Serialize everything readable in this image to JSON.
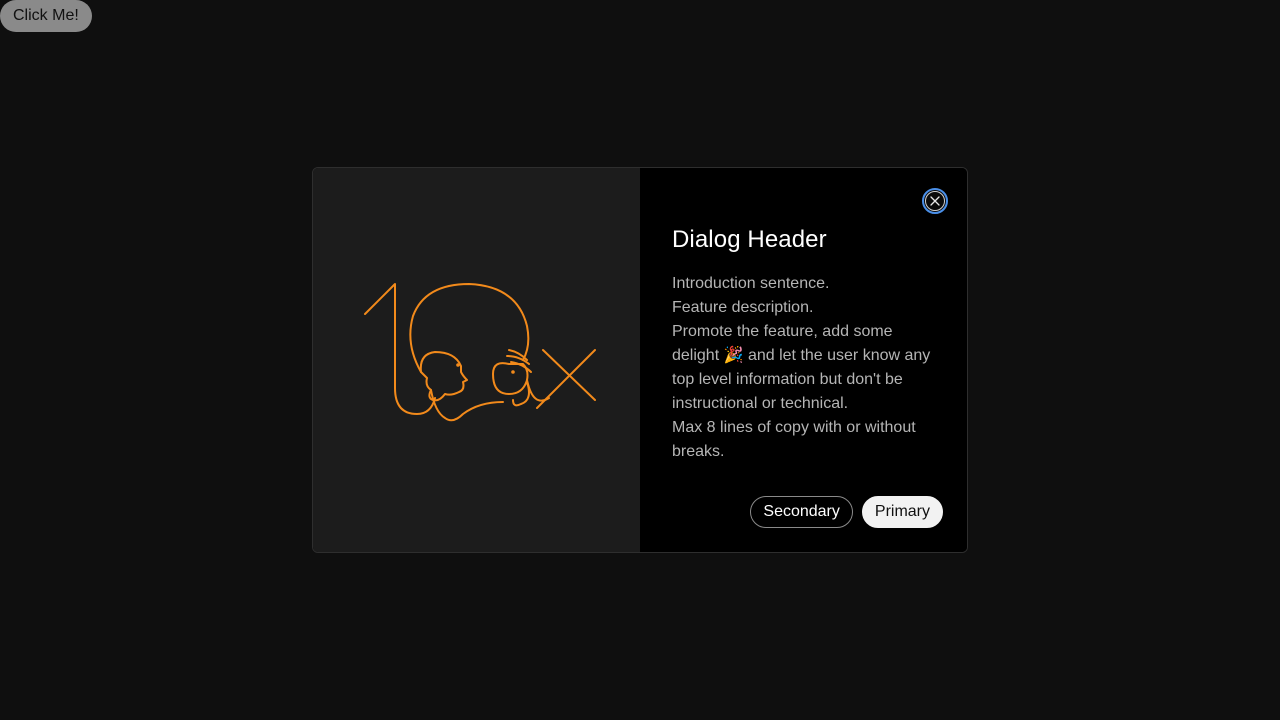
{
  "trigger": {
    "label": "Click Me!"
  },
  "dialog": {
    "header": "Dialog Header",
    "paragraphs": [
      "Introduction sentence.",
      "Feature description.",
      "Promote the feature, add some delight 🎉 and let the user know any top level information but don't be instructional or technical.",
      "Max 8 lines of copy with or without breaks."
    ],
    "secondary_label": "Secondary",
    "primary_label": "Primary",
    "close_icon": "close-icon",
    "illustration_icon": "10x-illustration-icon"
  },
  "colors": {
    "background": "#0f0f0f",
    "hero_panel": "#1c1c1c",
    "content_panel": "#000000",
    "illustration": "#f28a1b",
    "focus_ring": "#4a8fe8"
  }
}
